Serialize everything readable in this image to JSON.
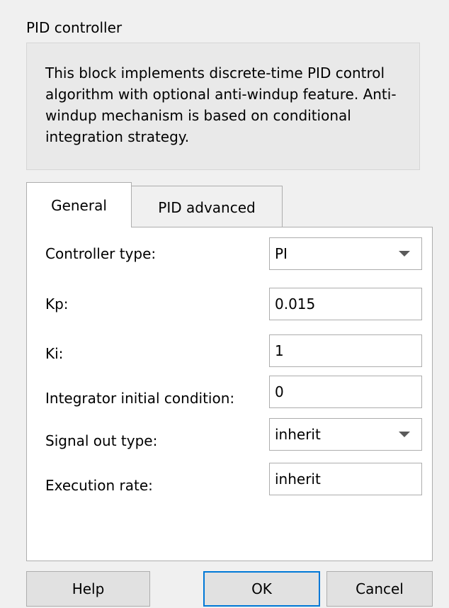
{
  "dialog": {
    "title": "PID controller",
    "description": "This block implements discrete-time PID control algorithm with optional anti-windup feature. Anti-windup mechanism is based on conditional integration strategy."
  },
  "tabs": [
    {
      "label": "General",
      "active": true
    },
    {
      "label": "PID advanced",
      "active": false
    }
  ],
  "fields": {
    "controller_type": {
      "label": "Controller type:",
      "value": "PI",
      "kind": "dropdown"
    },
    "kp": {
      "label": "Kp:",
      "value": "0.015",
      "kind": "text"
    },
    "ki": {
      "label": "Ki:",
      "value": "1",
      "kind": "text"
    },
    "integrator_ic": {
      "label": "Integrator initial condition:",
      "value": "0",
      "kind": "text"
    },
    "signal_out_type": {
      "label": "Signal out type:",
      "value": "inherit",
      "kind": "dropdown"
    },
    "execution_rate": {
      "label": "Execution rate:",
      "value": "inherit",
      "kind": "text"
    }
  },
  "buttons": {
    "help": "Help",
    "ok": "OK",
    "cancel": "Cancel"
  },
  "colors": {
    "background": "#f0f0f0",
    "panel": "#ffffff",
    "border": "#adadad",
    "focus": "#0078d7"
  },
  "icons": {
    "dropdown": "chevron-down-icon"
  }
}
